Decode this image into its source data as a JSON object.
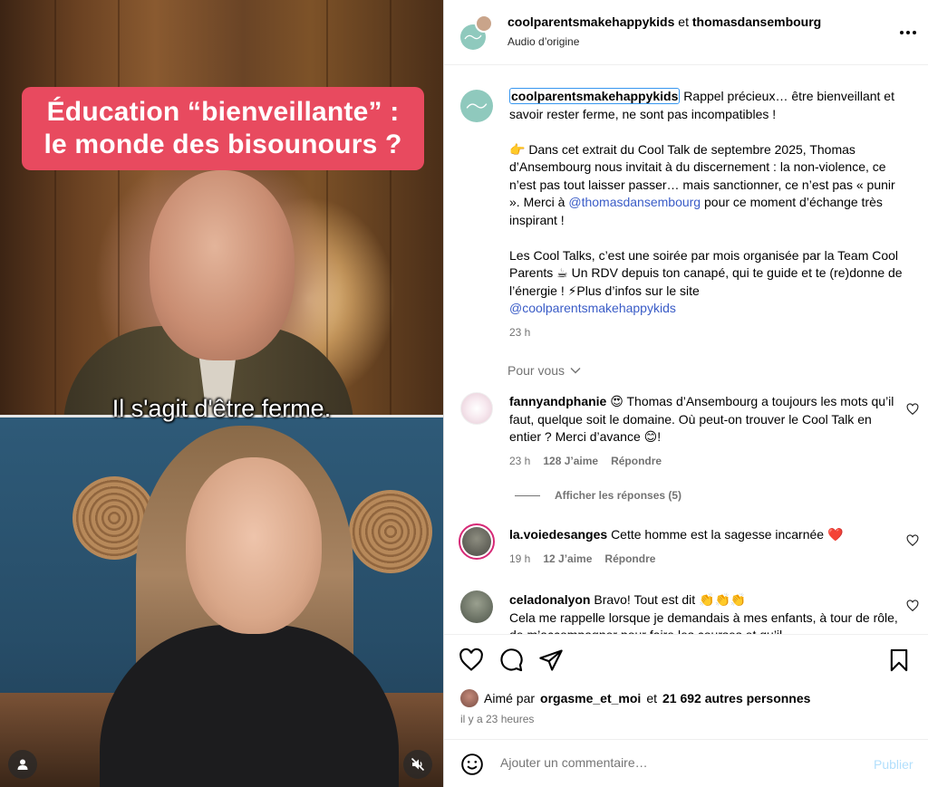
{
  "video": {
    "title_line1": "Éducation “bienveillante” :",
    "title_line2": "le monde des bisounours ?",
    "subtitle": "Il s'agit d'être ferme.",
    "left_icon": "user-tag-icon",
    "right_icon": "muted-speaker-icon"
  },
  "header": {
    "user1": "coolparentsmakehappykids",
    "joiner": "et",
    "user2": "thomasdansembourg",
    "audio": "Audio d’origine",
    "menu_icon": "more-horizontal-icon"
  },
  "caption": {
    "username": "coolparentsmakehappykids",
    "p1": "Rappel précieux… être bienveillant et savoir rester ferme, ne sont pas incompatibles !",
    "p2_before": "👉 Dans cet extrait du Cool Talk de septembre 2025, Thomas d’Ansembourg nous invitait à du discernement : la non-violence, ce n’est pas tout laisser passer… mais sanctionner, ce n’est pas « punir ». Merci à ",
    "p2_mention": "@thomasdansembourg",
    "p2_after": " pour ce moment d’échange très inspirant !",
    "p3": "Les Cool Talks, c’est une soirée par mois organisée par la Team Cool Parents ☕ Un RDV depuis ton canapé, qui te guide et te (re)donne de l’énergie ! ⚡Plus d’infos sur le site",
    "p3_mention": "@coolparentsmakehappykids",
    "time": "23 h"
  },
  "pour_vous": "Pour vous",
  "comments": [
    {
      "user": "fannyandphanie",
      "text": "😍 Thomas d’Ansembourg a toujours les mots qu’il faut, quelque soit le domaine. Où peut-on trouver le Cool Talk en entier ? Merci d’avance 😊!",
      "time": "23 h",
      "likes": "128 J’aime",
      "reply": "Répondre"
    },
    {
      "user": "la.voiedesanges",
      "text": "Cette homme est la sagesse incarnée ❤️",
      "time": "19 h",
      "likes": "12 J’aime",
      "reply": "Répondre"
    },
    {
      "user": "celadonalyon",
      "text": "Bravo! Tout est dit 👏👏👏",
      "text2": "Cela me rappelle lorsque je demandais à mes enfants, à tour de rôle, de m’accompagner pour faire les courses et qu’il"
    }
  ],
  "show_replies": "Afficher les réponses (5)",
  "actions": {
    "icons": [
      "heart-icon",
      "comment-icon",
      "share-icon",
      "bookmark-icon"
    ],
    "liked_by_prefix": "Aimé par",
    "liked_by_user": "orgasme_et_moi",
    "liked_by_joiner": "et",
    "liked_by_others": "21 692 autres personnes",
    "ago": "il y a 23 heures"
  },
  "add_comment": {
    "placeholder": "Ajouter un commentaire…",
    "publish": "Publier",
    "emoji_icon": "emoji-icon"
  },
  "colors": {
    "banner": "#e84a5f",
    "mention": "#3a5cc7",
    "publish": "#b2dffc",
    "muted": "#737373"
  }
}
